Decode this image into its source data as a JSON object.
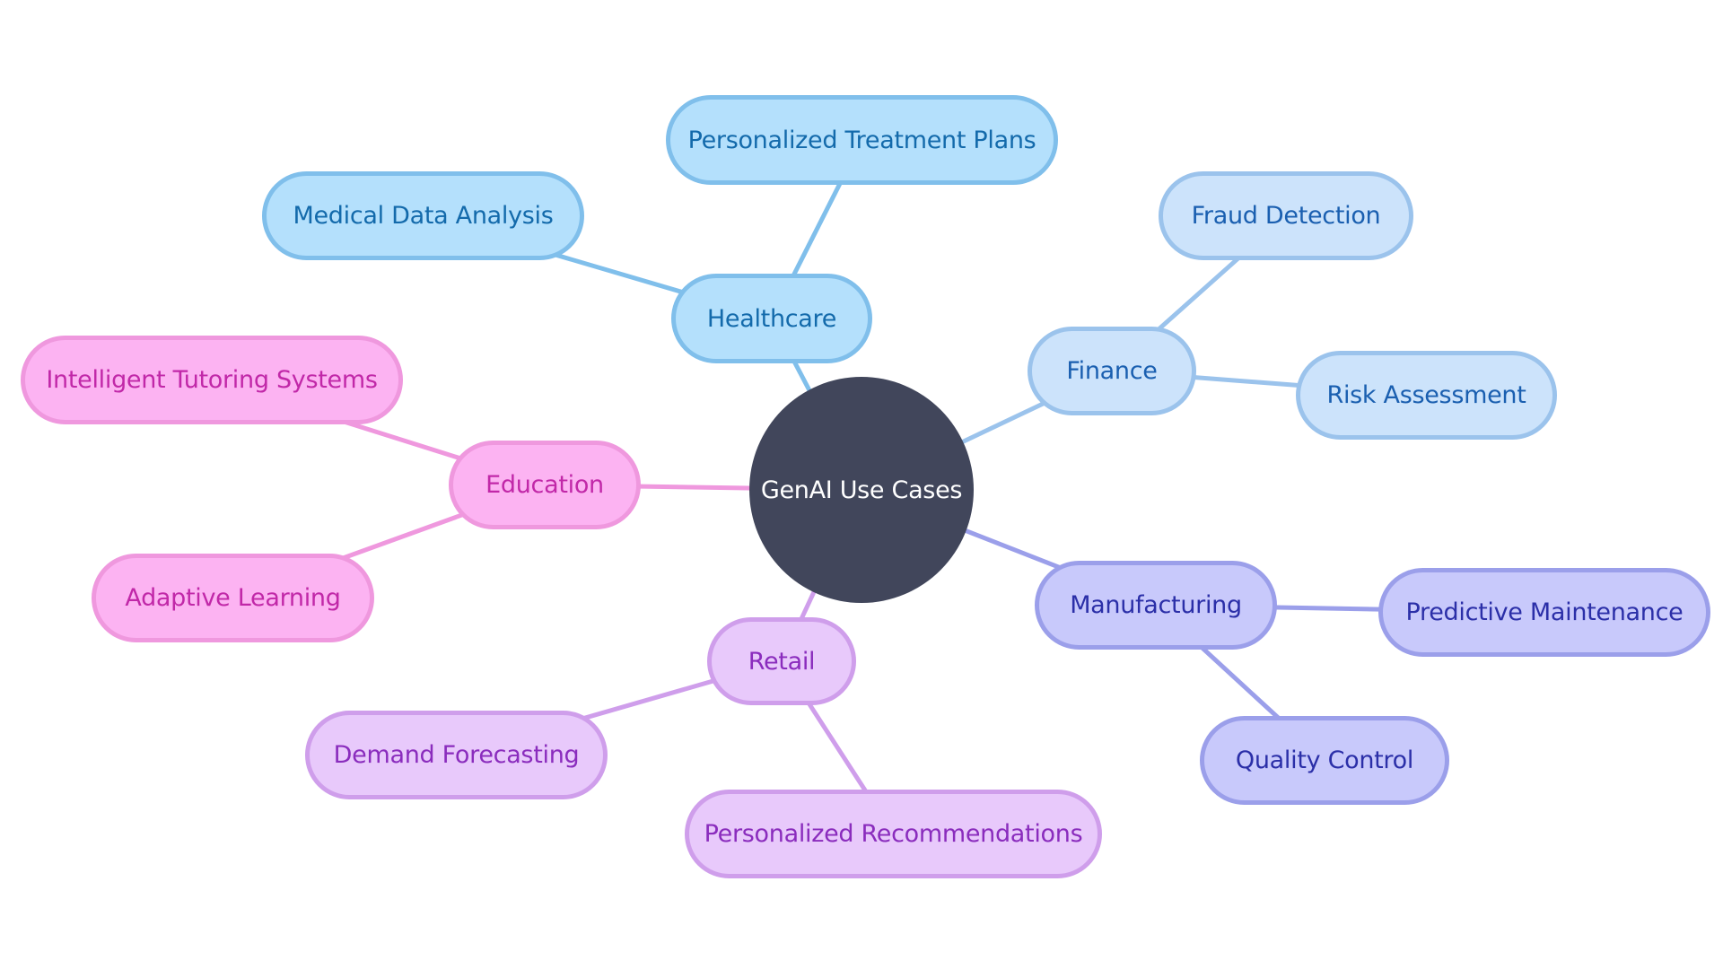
{
  "diagram": {
    "type": "mindmap",
    "root": {
      "id": "root",
      "label": "GenAI Use Cases",
      "color": "#41465b",
      "text_color": "#ffffff"
    },
    "branches": [
      {
        "id": "healthcare",
        "label": "Healthcare",
        "palette": "c-health",
        "edge_color": "#80bfeb",
        "children": [
          {
            "id": "personalized-treatment-plans",
            "label": "Personalized Treatment Plans"
          },
          {
            "id": "medical-data-analysis",
            "label": "Medical Data Analysis"
          }
        ]
      },
      {
        "id": "finance",
        "label": "Finance",
        "palette": "c-fin",
        "edge_color": "#9bc3ec",
        "children": [
          {
            "id": "fraud-detection",
            "label": "Fraud Detection"
          },
          {
            "id": "risk-assessment",
            "label": "Risk Assessment"
          }
        ]
      },
      {
        "id": "manufacturing",
        "label": "Manufacturing",
        "palette": "c-man",
        "edge_color": "#9b9fea",
        "children": [
          {
            "id": "predictive-maintenance",
            "label": "Predictive Maintenance"
          },
          {
            "id": "quality-control",
            "label": "Quality Control"
          }
        ]
      },
      {
        "id": "retail",
        "label": "Retail",
        "palette": "c-ret",
        "edge_color": "#cf9eeb",
        "children": [
          {
            "id": "demand-forecasting",
            "label": "Demand Forecasting"
          },
          {
            "id": "personalized-recommendations",
            "label": "Personalized Recommendations"
          }
        ]
      },
      {
        "id": "education",
        "label": "Education",
        "palette": "c-edu",
        "edge_color": "#ef98de",
        "children": [
          {
            "id": "intelligent-tutoring-systems",
            "label": "Intelligent Tutoring Systems"
          },
          {
            "id": "adaptive-learning",
            "label": "Adaptive Learning"
          }
        ]
      }
    ]
  }
}
